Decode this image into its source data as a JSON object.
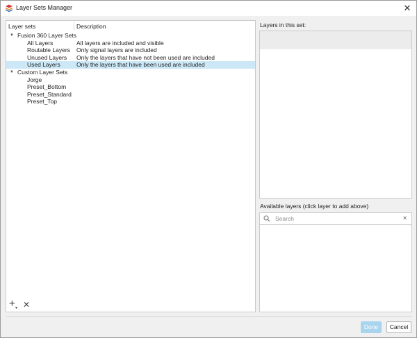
{
  "window": {
    "title": "Layer Sets Manager",
    "close_glyph": "✕",
    "app_icon": "layers-stack-icon"
  },
  "layer_sets_table": {
    "columns": [
      "Layer sets",
      "Description"
    ],
    "groups": [
      {
        "label": "Fusion 360 Layer Sets",
        "expanded": true,
        "items": [
          {
            "name": "All Layers",
            "description": "All layers are included and visible",
            "selected": false
          },
          {
            "name": "Routable Layers",
            "description": "Only signal layers are included",
            "selected": false
          },
          {
            "name": "Unused Layers",
            "description": "Only the layers that have not been used are included",
            "selected": false
          },
          {
            "name": "Used Layers",
            "description": "Only the layers that have been used are included",
            "selected": true
          }
        ]
      },
      {
        "label": "Custom Layer Sets",
        "expanded": true,
        "items": [
          {
            "name": "Jorge",
            "description": ""
          },
          {
            "name": "Preset_Bottom",
            "description": ""
          },
          {
            "name": "Preset_Standard",
            "description": ""
          },
          {
            "name": "Preset_Top",
            "description": ""
          }
        ]
      }
    ],
    "expand_glyph": "▼"
  },
  "tools": {
    "add_glyph": "+",
    "add_caret": "▼",
    "delete_glyph": "✕"
  },
  "layers_in_set": {
    "label": "Layers in this set:"
  },
  "available_layers": {
    "label": "Available layers (click layer to add above)",
    "search_placeholder": "Search",
    "clear_glyph": "✕"
  },
  "footer": {
    "done_label": "Done",
    "cancel_label": "Cancel"
  },
  "colors": {
    "selection": "#cce8f7",
    "done_button_disabled": "#a8d4ee"
  }
}
